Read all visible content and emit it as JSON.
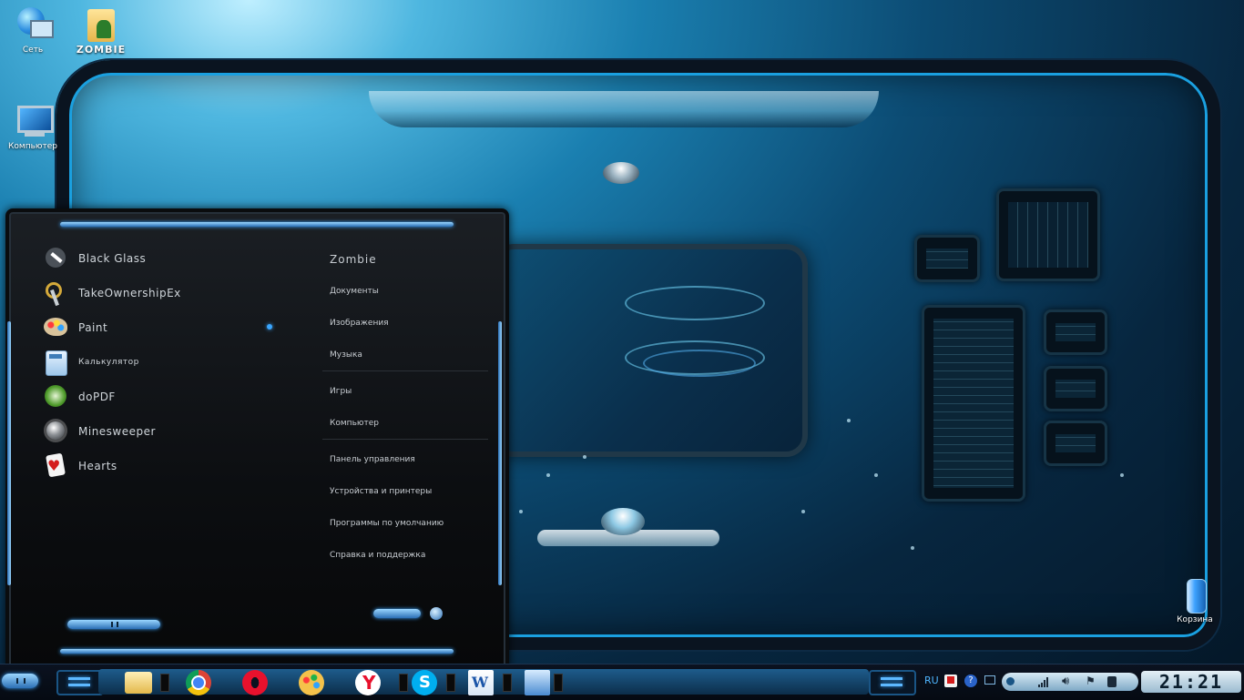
{
  "desktop": {
    "icons": [
      {
        "label": "Сеть",
        "icon": "network-icon"
      },
      {
        "label": "ZOMBIE",
        "icon": "user-folder-icon"
      },
      {
        "label": "Компьютер",
        "icon": "computer-icon"
      },
      {
        "label": "Корзина",
        "icon": "recycle-bin-icon"
      }
    ]
  },
  "start_menu": {
    "programs": [
      {
        "label": "Black Glass",
        "icon": "brush-icon"
      },
      {
        "label": "TakeOwnershipEx",
        "icon": "keys-icon"
      },
      {
        "label": "Paint",
        "icon": "paint-palette-icon"
      },
      {
        "label": "Калькулятор",
        "icon": "calculator-icon"
      },
      {
        "label": "doPDF",
        "icon": "dopdf-icon"
      },
      {
        "label": "Minesweeper",
        "icon": "mine-icon"
      },
      {
        "label": "Hearts",
        "icon": "hearts-card-icon"
      }
    ],
    "places": {
      "user": "Zombie",
      "documents": "Документы",
      "pictures": "Изображения",
      "music": "Музыка",
      "games": "Игры",
      "computer": "Компьютер",
      "control_panel": "Панель управления",
      "devices": "Устройства и принтеры",
      "default_programs": "Программы по умолчанию",
      "help": "Справка и поддержка"
    }
  },
  "taskbar": {
    "apps": [
      {
        "name": "explorer",
        "icon": "folder-icon"
      },
      {
        "name": "chrome",
        "icon": "chrome-icon"
      },
      {
        "name": "opera",
        "icon": "opera-icon"
      },
      {
        "name": "paint",
        "icon": "paint-icon"
      },
      {
        "name": "yandex",
        "icon": "yandex-icon"
      },
      {
        "name": "skype",
        "icon": "skype-icon"
      },
      {
        "name": "word",
        "icon": "word-icon"
      },
      {
        "name": "control-panel",
        "icon": "control-panel-icon"
      }
    ],
    "tray": {
      "language": "RU",
      "clock": "21:21"
    }
  }
}
